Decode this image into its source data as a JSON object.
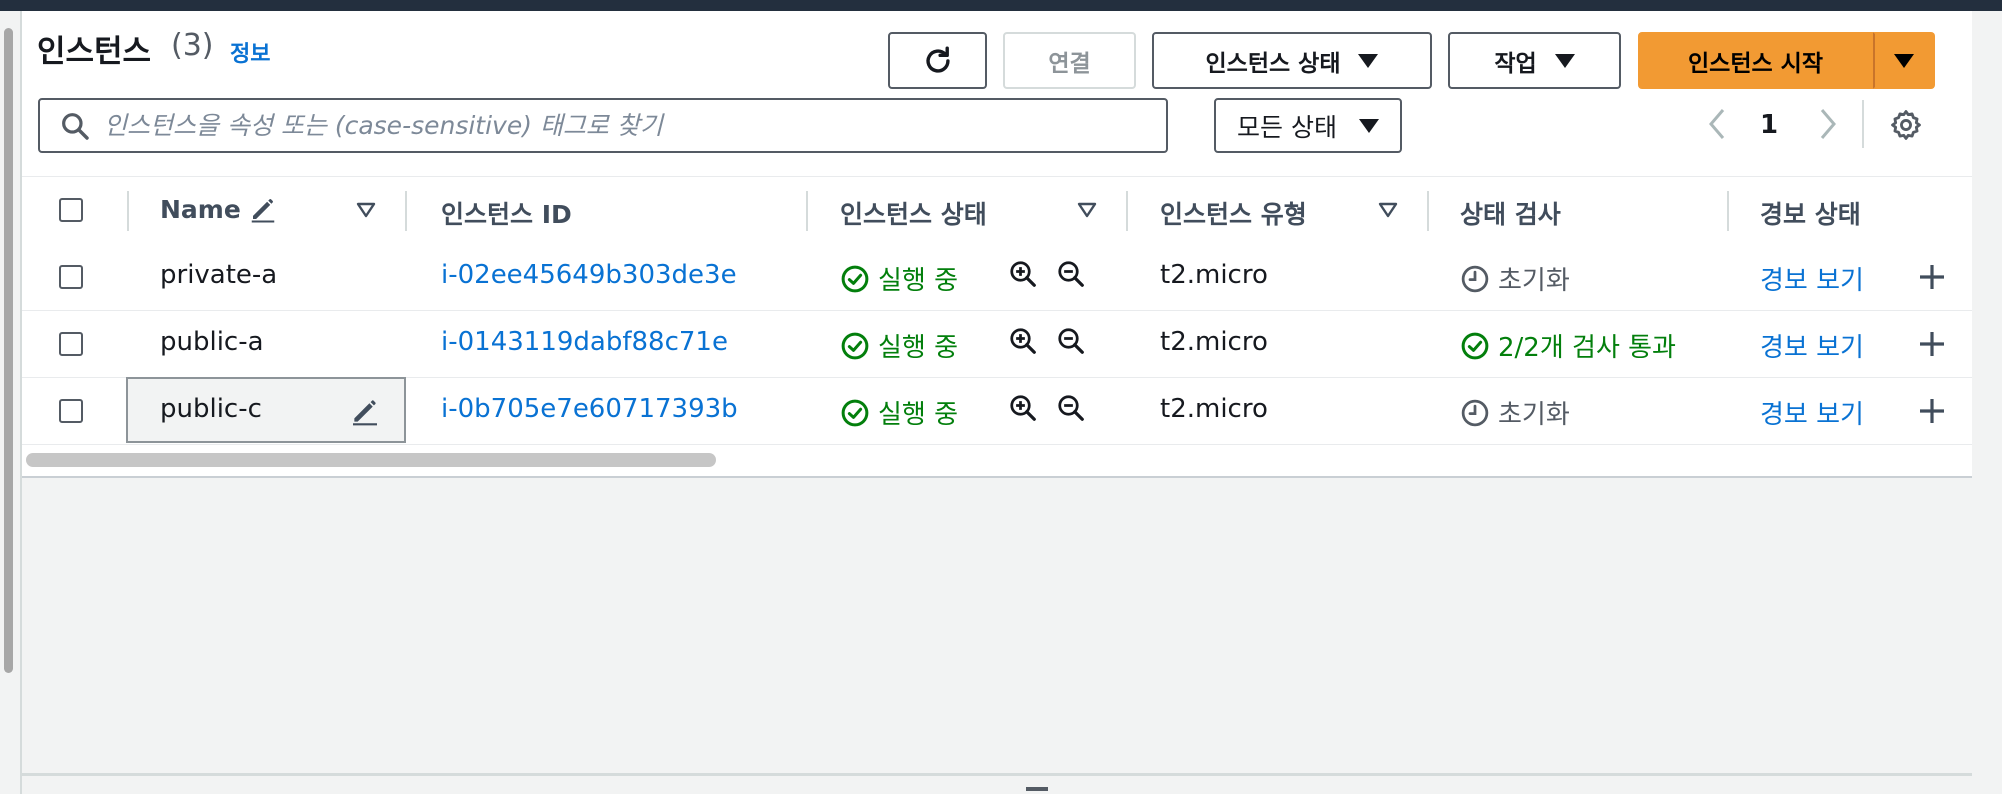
{
  "header": {
    "title": "인스턴스",
    "count": "(3)",
    "info_link": "정보"
  },
  "toolbar": {
    "refresh_icon": "refresh-icon",
    "connect_label": "연결",
    "instance_state_label": "인스턴스 상태",
    "actions_label": "작업",
    "launch_label": "인스턴스 시작",
    "accent": "#f29a33"
  },
  "search": {
    "placeholder": "인스턴스을 속성 또는 (case-sensitive) 태그로 찾기"
  },
  "state_filter": {
    "label": "모든 상태"
  },
  "pagination": {
    "page": "1"
  },
  "table": {
    "columns": [
      "Name",
      "인스턴스 ID",
      "인스턴스 상태",
      "인스턴스 유형",
      "상태 검사",
      "경보 상태"
    ],
    "rows": [
      {
        "name": "private-a",
        "id": "i-02ee45649b303de3e",
        "state": "실행 중",
        "type": "t2.micro",
        "check": "초기화",
        "check_kind": "initializing",
        "alarm": "경보 보기"
      },
      {
        "name": "public-a",
        "id": "i-0143119dabf88c71e",
        "state": "실행 중",
        "type": "t2.micro",
        "check": "2/2개 검사 통과",
        "check_kind": "passed",
        "alarm": "경보 보기"
      },
      {
        "name": "public-c",
        "id": "i-0b705e7e60717393b",
        "state": "실행 중",
        "type": "t2.micro",
        "check": "초기화",
        "check_kind": "initializing",
        "alarm": "경보 보기"
      }
    ]
  },
  "colors": {
    "link": "#0972d3",
    "success": "#037f0c",
    "dark_header": "#232f3e"
  }
}
